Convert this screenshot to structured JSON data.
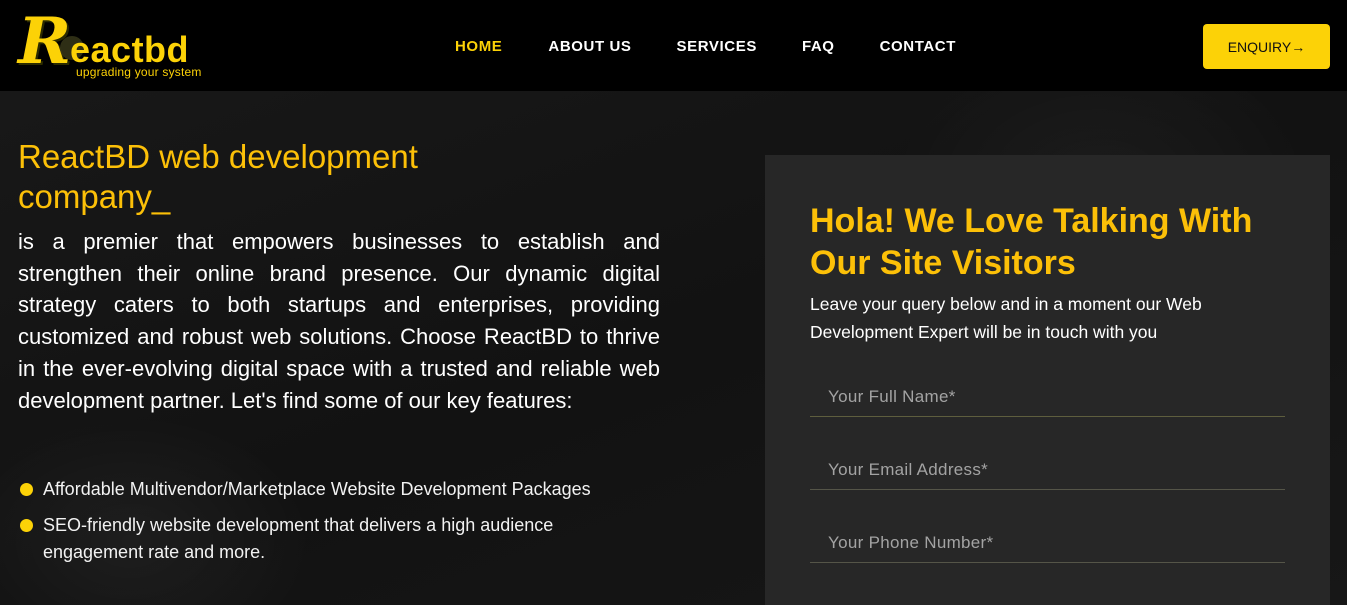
{
  "header": {
    "logo": {
      "mark": "R",
      "name": "eactbd",
      "tagline": "upgrading your system"
    },
    "nav": [
      {
        "label": "HOME",
        "active": true
      },
      {
        "label": "ABOUT US",
        "active": false
      },
      {
        "label": "SERVICES",
        "active": false
      },
      {
        "label": "FAQ",
        "active": false
      },
      {
        "label": "CONTACT",
        "active": false
      }
    ],
    "enquiry_label": "ENQUIRY→"
  },
  "hero": {
    "title": "ReactBD web development company_",
    "description": "is a premier that empowers businesses to establish and strengthen their online brand presence. Our dynamic digital strategy caters to both startups and enterprises, providing customized and robust web solutions. Choose ReactBD to thrive in the ever-evolving digital space with a trusted and reliable web development partner. Let's find some of our key features:",
    "features": [
      "Affordable Multivendor/Marketplace Website Development Packages",
      "SEO-friendly website development that delivers a high audience engagement rate and more."
    ]
  },
  "form": {
    "title": "Hola! We Love Talking With Our Site Visitors",
    "subtitle": "Leave your query below and in a moment our Web Development Expert will be in touch with you",
    "fields": {
      "name_placeholder": "Your Full Name*",
      "email_placeholder": "Your Email Address*",
      "phone_placeholder": "Your Phone Number*"
    }
  },
  "colors": {
    "accent": "#fcd207",
    "header_bg": "#000000",
    "page_bg": "#141414",
    "panel_bg": "#272727"
  }
}
